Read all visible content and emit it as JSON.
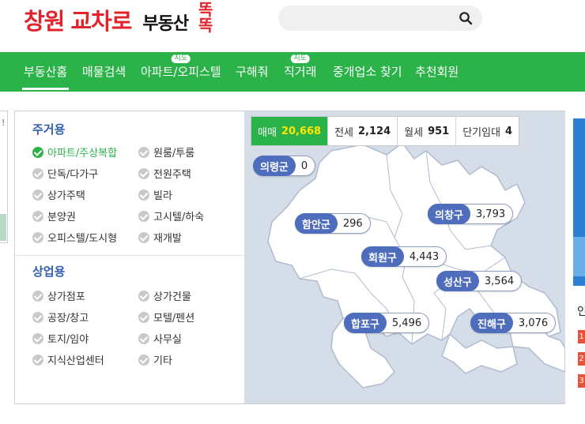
{
  "header": {
    "logo": {
      "part1": "창원",
      "part2": "교차로",
      "part3": "부동산",
      "part4a": "똑",
      "part4b": "똑"
    },
    "search": {
      "placeholder": "",
      "value": ""
    },
    "search_icon": "search-icon"
  },
  "nav": {
    "items": [
      {
        "label": "부동산홈",
        "badge": ""
      },
      {
        "label": "매물검색",
        "badge": ""
      },
      {
        "label": "아파트/오피스텔",
        "badge": "지도"
      },
      {
        "label": "구해줘",
        "badge": ""
      },
      {
        "label": "직거래",
        "badge": "지도"
      },
      {
        "label": "중개업소 찾기",
        "badge": ""
      },
      {
        "label": "추천회원",
        "badge": ""
      }
    ]
  },
  "filters": {
    "residential_title": "주거용",
    "residential": [
      {
        "label": "아파트/주상복합",
        "selected": true
      },
      {
        "label": "원룸/투룸",
        "selected": false
      },
      {
        "label": "단독/다가구",
        "selected": false
      },
      {
        "label": "전원주택",
        "selected": false
      },
      {
        "label": "상가주택",
        "selected": false
      },
      {
        "label": "빌라",
        "selected": false
      },
      {
        "label": "분양권",
        "selected": false
      },
      {
        "label": "고시텔/하숙",
        "selected": false
      },
      {
        "label": "오피스텔/도시형",
        "selected": false
      },
      {
        "label": "재개발",
        "selected": false
      }
    ],
    "commercial_title": "상업용",
    "commercial": [
      {
        "label": "상가점포",
        "selected": false
      },
      {
        "label": "상가건물",
        "selected": false
      },
      {
        "label": "공장/창고",
        "selected": false
      },
      {
        "label": "모텔/펜션",
        "selected": false
      },
      {
        "label": "토지/임야",
        "selected": false
      },
      {
        "label": "사무실",
        "selected": false
      },
      {
        "label": "지식산업센터",
        "selected": false
      },
      {
        "label": "기타",
        "selected": false
      }
    ]
  },
  "stats": [
    {
      "label": "매매",
      "value": "20,668",
      "active": true
    },
    {
      "label": "전세",
      "value": "2,124",
      "active": false
    },
    {
      "label": "월세",
      "value": "951",
      "active": false
    },
    {
      "label": "단기임대",
      "value": "4",
      "active": false
    }
  ],
  "regions": [
    {
      "name": "의령군",
      "count": "0"
    },
    {
      "name": "함안군",
      "count": "296"
    },
    {
      "name": "의창구",
      "count": "3,793"
    },
    {
      "name": "회원구",
      "count": "4,443"
    },
    {
      "name": "성산구",
      "count": "3,564"
    },
    {
      "name": "합포구",
      "count": "5,496"
    },
    {
      "name": "진해구",
      "count": "3,076"
    }
  ],
  "colors": {
    "brand_red": "#e3232b",
    "nav_green": "#2bb34a",
    "region_blue": "#4f6dbd",
    "highlight_yellow": "#ffe600",
    "map_bg": "#d5dde8"
  },
  "side": {
    "left_mark": "!",
    "right_text": "인",
    "right_badges": [
      "1",
      "2",
      "3"
    ]
  }
}
